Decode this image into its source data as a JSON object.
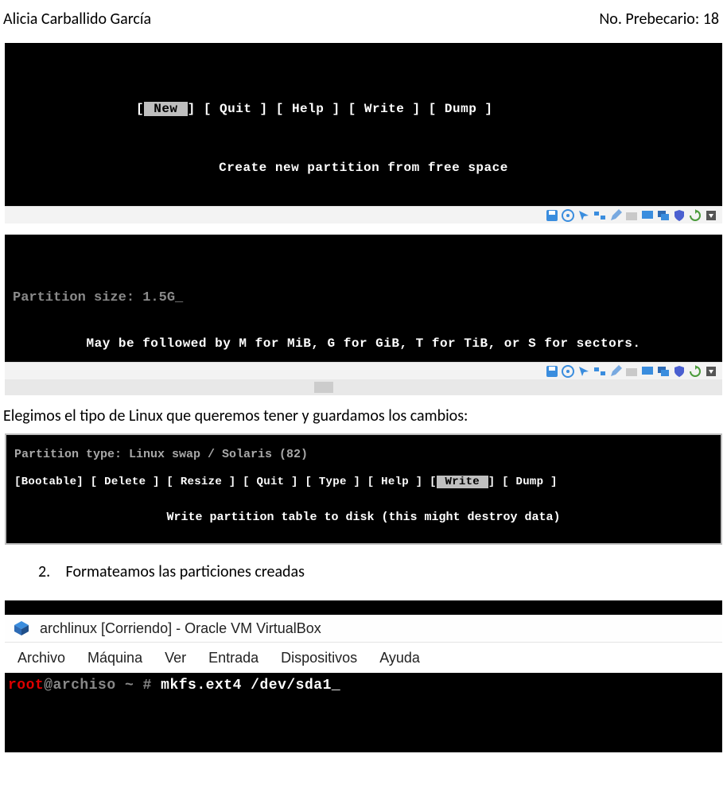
{
  "header": {
    "name": "Alicia Carballido García",
    "prebecario_label": "No. Prebecario: 18"
  },
  "shot1": {
    "menu": {
      "new_l": "[",
      "new_sel": "  New  ",
      "new_r": "]",
      "rest": "  [  Quit  ]  [  Help  ]  [  Write ]  [  Dump  ]"
    },
    "caption": "Create new partition from free space"
  },
  "vmbar_icons": [
    "save-icon",
    "disc-icon",
    "pointer-icon",
    "net-icon",
    "pen-icon",
    "folder-icon",
    "screen-icon",
    "screen2-icon",
    "shield-icon",
    "refresh-icon",
    "menu-icon"
  ],
  "shot2": {
    "prompt_label": "Partition size: ",
    "prompt_value": "1.5G",
    "cursor": "_",
    "followed": "May be followed by M for MiB, G for GiB, T for TiB, or S for sectors."
  },
  "paragraph1": "Elegimos el tipo de Linux que queremos tener y guardamos los cambios:",
  "shot3": {
    "line1": "Partition type: Linux swap / Solaris (82)",
    "menu_left": " [Bootable]  [ Delete ]  [ Resize ]  [  Quit  ]  [  Type  ]  [  Help  ]  ",
    "menu_sel_l": "[",
    "menu_sel": " Write ",
    "menu_sel_r": "]",
    "menu_right": "  [  Dump  ]",
    "caption": "Write partition table to disk (this might destroy data)"
  },
  "list_item": {
    "num": "2.",
    "text": "Formateamos las particiones creadas"
  },
  "shot4": {
    "title": "archlinux [Corriendo] - Oracle VM VirtualBox",
    "menus": [
      "Archivo",
      "Máquina",
      "Ver",
      "Entrada",
      "Dispositivos",
      "Ayuda"
    ],
    "term": {
      "root": "root",
      "at_host": "@archiso ",
      "tilde": "~ ",
      "hash": "# ",
      "cmd": "mkfs.ext4 /dev/sda1",
      "cursor": "_"
    }
  }
}
